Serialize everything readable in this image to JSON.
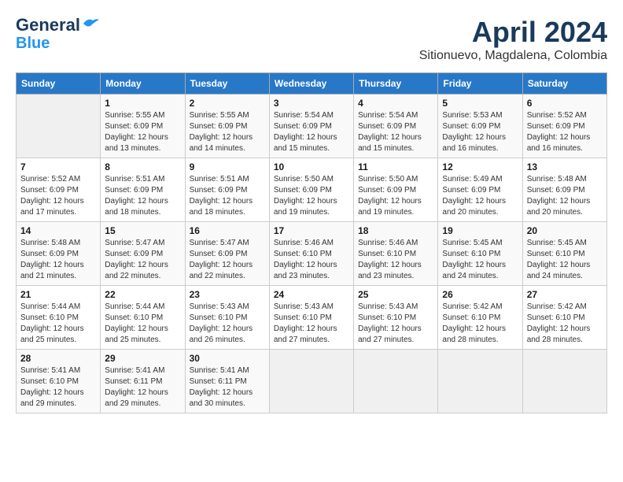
{
  "header": {
    "logo_line1": "General",
    "logo_line2": "Blue",
    "month_title": "April 2024",
    "location": "Sitionuevo, Magdalena, Colombia"
  },
  "weekdays": [
    "Sunday",
    "Monday",
    "Tuesday",
    "Wednesday",
    "Thursday",
    "Friday",
    "Saturday"
  ],
  "weeks": [
    [
      {
        "day": "",
        "sunrise": "",
        "sunset": "",
        "daylight": ""
      },
      {
        "day": "1",
        "sunrise": "Sunrise: 5:55 AM",
        "sunset": "Sunset: 6:09 PM",
        "daylight": "Daylight: 12 hours and 13 minutes."
      },
      {
        "day": "2",
        "sunrise": "Sunrise: 5:55 AM",
        "sunset": "Sunset: 6:09 PM",
        "daylight": "Daylight: 12 hours and 14 minutes."
      },
      {
        "day": "3",
        "sunrise": "Sunrise: 5:54 AM",
        "sunset": "Sunset: 6:09 PM",
        "daylight": "Daylight: 12 hours and 15 minutes."
      },
      {
        "day": "4",
        "sunrise": "Sunrise: 5:54 AM",
        "sunset": "Sunset: 6:09 PM",
        "daylight": "Daylight: 12 hours and 15 minutes."
      },
      {
        "day": "5",
        "sunrise": "Sunrise: 5:53 AM",
        "sunset": "Sunset: 6:09 PM",
        "daylight": "Daylight: 12 hours and 16 minutes."
      },
      {
        "day": "6",
        "sunrise": "Sunrise: 5:52 AM",
        "sunset": "Sunset: 6:09 PM",
        "daylight": "Daylight: 12 hours and 16 minutes."
      }
    ],
    [
      {
        "day": "7",
        "sunrise": "Sunrise: 5:52 AM",
        "sunset": "Sunset: 6:09 PM",
        "daylight": "Daylight: 12 hours and 17 minutes."
      },
      {
        "day": "8",
        "sunrise": "Sunrise: 5:51 AM",
        "sunset": "Sunset: 6:09 PM",
        "daylight": "Daylight: 12 hours and 18 minutes."
      },
      {
        "day": "9",
        "sunrise": "Sunrise: 5:51 AM",
        "sunset": "Sunset: 6:09 PM",
        "daylight": "Daylight: 12 hours and 18 minutes."
      },
      {
        "day": "10",
        "sunrise": "Sunrise: 5:50 AM",
        "sunset": "Sunset: 6:09 PM",
        "daylight": "Daylight: 12 hours and 19 minutes."
      },
      {
        "day": "11",
        "sunrise": "Sunrise: 5:50 AM",
        "sunset": "Sunset: 6:09 PM",
        "daylight": "Daylight: 12 hours and 19 minutes."
      },
      {
        "day": "12",
        "sunrise": "Sunrise: 5:49 AM",
        "sunset": "Sunset: 6:09 PM",
        "daylight": "Daylight: 12 hours and 20 minutes."
      },
      {
        "day": "13",
        "sunrise": "Sunrise: 5:48 AM",
        "sunset": "Sunset: 6:09 PM",
        "daylight": "Daylight: 12 hours and 20 minutes."
      }
    ],
    [
      {
        "day": "14",
        "sunrise": "Sunrise: 5:48 AM",
        "sunset": "Sunset: 6:09 PM",
        "daylight": "Daylight: 12 hours and 21 minutes."
      },
      {
        "day": "15",
        "sunrise": "Sunrise: 5:47 AM",
        "sunset": "Sunset: 6:09 PM",
        "daylight": "Daylight: 12 hours and 22 minutes."
      },
      {
        "day": "16",
        "sunrise": "Sunrise: 5:47 AM",
        "sunset": "Sunset: 6:09 PM",
        "daylight": "Daylight: 12 hours and 22 minutes."
      },
      {
        "day": "17",
        "sunrise": "Sunrise: 5:46 AM",
        "sunset": "Sunset: 6:10 PM",
        "daylight": "Daylight: 12 hours and 23 minutes."
      },
      {
        "day": "18",
        "sunrise": "Sunrise: 5:46 AM",
        "sunset": "Sunset: 6:10 PM",
        "daylight": "Daylight: 12 hours and 23 minutes."
      },
      {
        "day": "19",
        "sunrise": "Sunrise: 5:45 AM",
        "sunset": "Sunset: 6:10 PM",
        "daylight": "Daylight: 12 hours and 24 minutes."
      },
      {
        "day": "20",
        "sunrise": "Sunrise: 5:45 AM",
        "sunset": "Sunset: 6:10 PM",
        "daylight": "Daylight: 12 hours and 24 minutes."
      }
    ],
    [
      {
        "day": "21",
        "sunrise": "Sunrise: 5:44 AM",
        "sunset": "Sunset: 6:10 PM",
        "daylight": "Daylight: 12 hours and 25 minutes."
      },
      {
        "day": "22",
        "sunrise": "Sunrise: 5:44 AM",
        "sunset": "Sunset: 6:10 PM",
        "daylight": "Daylight: 12 hours and 25 minutes."
      },
      {
        "day": "23",
        "sunrise": "Sunrise: 5:43 AM",
        "sunset": "Sunset: 6:10 PM",
        "daylight": "Daylight: 12 hours and 26 minutes."
      },
      {
        "day": "24",
        "sunrise": "Sunrise: 5:43 AM",
        "sunset": "Sunset: 6:10 PM",
        "daylight": "Daylight: 12 hours and 27 minutes."
      },
      {
        "day": "25",
        "sunrise": "Sunrise: 5:43 AM",
        "sunset": "Sunset: 6:10 PM",
        "daylight": "Daylight: 12 hours and 27 minutes."
      },
      {
        "day": "26",
        "sunrise": "Sunrise: 5:42 AM",
        "sunset": "Sunset: 6:10 PM",
        "daylight": "Daylight: 12 hours and 28 minutes."
      },
      {
        "day": "27",
        "sunrise": "Sunrise: 5:42 AM",
        "sunset": "Sunset: 6:10 PM",
        "daylight": "Daylight: 12 hours and 28 minutes."
      }
    ],
    [
      {
        "day": "28",
        "sunrise": "Sunrise: 5:41 AM",
        "sunset": "Sunset: 6:10 PM",
        "daylight": "Daylight: 12 hours and 29 minutes."
      },
      {
        "day": "29",
        "sunrise": "Sunrise: 5:41 AM",
        "sunset": "Sunset: 6:11 PM",
        "daylight": "Daylight: 12 hours and 29 minutes."
      },
      {
        "day": "30",
        "sunrise": "Sunrise: 5:41 AM",
        "sunset": "Sunset: 6:11 PM",
        "daylight": "Daylight: 12 hours and 30 minutes."
      },
      {
        "day": "",
        "sunrise": "",
        "sunset": "",
        "daylight": ""
      },
      {
        "day": "",
        "sunrise": "",
        "sunset": "",
        "daylight": ""
      },
      {
        "day": "",
        "sunrise": "",
        "sunset": "",
        "daylight": ""
      },
      {
        "day": "",
        "sunrise": "",
        "sunset": "",
        "daylight": ""
      }
    ]
  ]
}
